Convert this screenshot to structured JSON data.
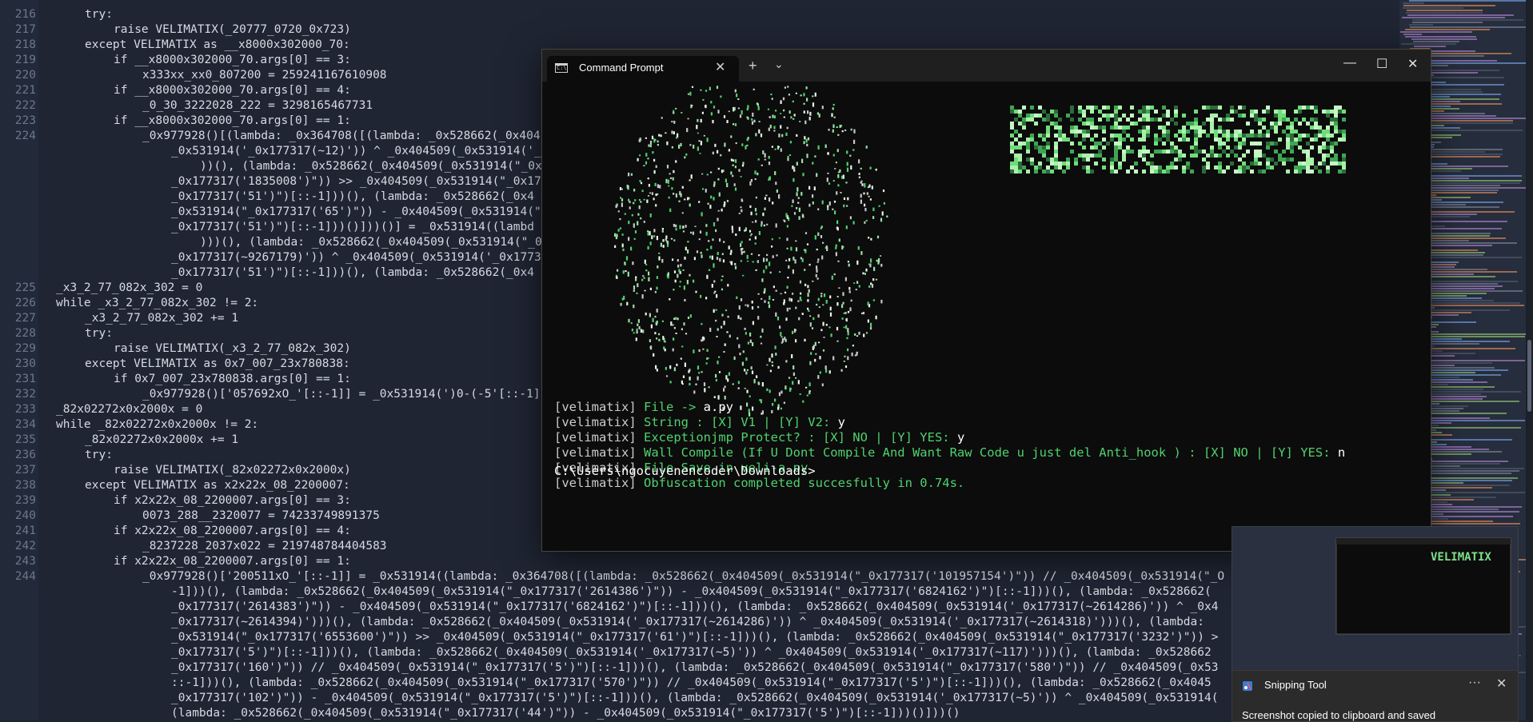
{
  "editor": {
    "lines": [
      {
        "n": "216",
        "indent": 1,
        "code": "try:"
      },
      {
        "n": "217",
        "indent": 2,
        "code": "raise VELIMATIX(_20777_0720_0x723)"
      },
      {
        "n": "218",
        "indent": 1,
        "code": "except VELIMATIX as __x8000x302000_70:"
      },
      {
        "n": "219",
        "indent": 2,
        "code": "if __x8000x302000_70.args[0] == 3:"
      },
      {
        "n": "220",
        "indent": 3,
        "code": "x333xx_xx0_807200 = 259241167610908"
      },
      {
        "n": "221",
        "indent": 2,
        "code": "if __x8000x302000_70.args[0] == 4:"
      },
      {
        "n": "222",
        "indent": 3,
        "code": "_0_30_3222028_222 = 3298165467731"
      },
      {
        "n": "223",
        "indent": 2,
        "code": "if __x8000x302000_70.args[0] == 1:"
      },
      {
        "n": "224",
        "indent": 3,
        "code": "_0x977928()[(lambda: _0x364708([(lambda: _0x528662(_0x404"
      },
      {
        "n": "",
        "indent": 4,
        "code": "_0x531914('_0x177317(~12)')) ^ _0x404509(_0x531914('_"
      },
      {
        "n": "",
        "indent": 5,
        "code": "))(), (lambda: _0x528662(_0x404509(_0x531914(\"_0x1773"
      },
      {
        "n": "",
        "indent": 4,
        "code": "_0x177317('1835008')\")) >> _0x404509(_0x531914(\"_0x17"
      },
      {
        "n": "",
        "indent": 4,
        "code": "_0x177317('51')\")[::-1]))(), (lambda: _0x528662(_0x4"
      },
      {
        "n": "",
        "indent": 4,
        "code": "_0x531914(\"_0x177317('65')\")) - _0x404509(_0x531914(\""
      },
      {
        "n": "",
        "indent": 4,
        "code": "_0x177317('51')\")[::-1]))()]))()] = _0x531914((lambd"
      },
      {
        "n": "",
        "indent": 5,
        "code": ")))(), (lambda: _0x528662(_0x404509(_0x531914(\"_0x177"
      },
      {
        "n": "",
        "indent": 4,
        "code": "_0x177317(~9267179)')) ^ _0x404509(_0x531914('_0x1773"
      },
      {
        "n": "",
        "indent": 4,
        "code": "_0x177317('51')\")[::-1]))(), (lambda: _0x528662(_0x4"
      },
      {
        "n": "225",
        "indent": 0,
        "code": "_x3_2_77_082x_302 = 0"
      },
      {
        "n": "226",
        "indent": 0,
        "code": "while _x3_2_77_082x_302 != 2:"
      },
      {
        "n": "227",
        "indent": 1,
        "code": "_x3_2_77_082x_302 += 1"
      },
      {
        "n": "228",
        "indent": 1,
        "code": "try:"
      },
      {
        "n": "229",
        "indent": 2,
        "code": "raise VELIMATIX(_x3_2_77_082x_302)"
      },
      {
        "n": "230",
        "indent": 1,
        "code": "except VELIMATIX as 0x7_007_23x780838:"
      },
      {
        "n": "231",
        "indent": 2,
        "code": "if 0x7_007_23x780838.args[0] == 1:"
      },
      {
        "n": "232",
        "indent": 3,
        "code": "_0x977928()['057692xO_'[::-1]] = _0x531914(')0-(-5'[::-1]"
      },
      {
        "n": "233",
        "indent": 0,
        "code": "_82x02272x0x2000x = 0"
      },
      {
        "n": "234",
        "indent": 0,
        "code": "while _82x02272x0x2000x != 2:"
      },
      {
        "n": "235",
        "indent": 1,
        "code": "_82x02272x0x2000x += 1"
      },
      {
        "n": "236",
        "indent": 1,
        "code": "try:"
      },
      {
        "n": "237",
        "indent": 2,
        "code": "raise VELIMATIX(_82x02272x0x2000x)"
      },
      {
        "n": "238",
        "indent": 1,
        "code": "except VELIMATIX as x2x22x_08_2200007:"
      },
      {
        "n": "239",
        "indent": 2,
        "code": "if x2x22x_08_2200007.args[0] == 3:"
      },
      {
        "n": "240",
        "indent": 3,
        "code": "0073_288__2320077 = 74233749891375"
      },
      {
        "n": "241",
        "indent": 2,
        "code": "if x2x22x_08_2200007.args[0] == 4:"
      },
      {
        "n": "242",
        "indent": 3,
        "code": "_8237228_2037x022 = 219748784404583"
      },
      {
        "n": "243",
        "indent": 2,
        "code": "if x2x22x_08_2200007.args[0] == 1:"
      },
      {
        "n": "244",
        "indent": 3,
        "code": "_0x977928()['200511xO_'[::-1]] = _0x531914((lambda: _0x364708([(lambda: _0x528662(_0x404509(_0x531914(\"_0x177317('101957154')\")) // _0x404509(_0x531914(\"_O"
      },
      {
        "n": "",
        "indent": 4,
        "code": "-1]))(), (lambda: _0x528662(_0x404509(_0x531914(\"_0x177317('2614386')\")) - _0x404509(_0x531914(\"_0x177317('6824162')\")[::-1]))(), (lambda: _0x528662("
      },
      {
        "n": "",
        "indent": 4,
        "code": "_0x177317('2614383')\")) - _0x404509(_0x531914(\"_0x177317('6824162')\")[::-1]))(), (lambda: _0x528662(_0x404509(_0x531914('_0x177317(~2614286)')) ^ _0x4"
      },
      {
        "n": "",
        "indent": 4,
        "code": "_0x177317(~2614394)')))(), (lambda: _0x528662(_0x404509(_0x531914('_0x177317(~2614286)')) ^ _0x404509(_0x531914('_0x177317(~2614318)')))(), (lambda:"
      },
      {
        "n": "",
        "indent": 4,
        "code": "_0x531914(\"_0x177317('6553600')\")) >> _0x404509(_0x531914(\"_0x177317('61')\")[::-1]))(), (lambda: _0x528662(_0x404509(_0x531914(\"_0x177317('3232')\")) >"
      },
      {
        "n": "",
        "indent": 4,
        "code": "_0x177317('5')\")[::-1]))(), (lambda: _0x528662(_0x404509(_0x531914('_0x177317(~5)')) ^ _0x404509(_0x531914('_0x177317(~117)')))(), (lambda: _0x528662"
      },
      {
        "n": "",
        "indent": 4,
        "code": "_0x177317('160')\")) // _0x404509(_0x531914(\"_0x177317('5')\")[::-1]))(), (lambda: _0x528662(_0x404509(_0x531914(\"_0x177317('580')\")) // _0x404509(_0x53"
      },
      {
        "n": "",
        "indent": 4,
        "code": "::-1]))(), (lambda: _0x528662(_0x404509(_0x531914(\"_0x177317('570')\")) // _0x404509(_0x531914(\"_0x177317('5')\")[::-1]))(), (lambda: _0x528662(_0x4045"
      },
      {
        "n": "",
        "indent": 4,
        "code": "_0x177317('102')\")) - _0x404509(_0x531914(\"_0x177317('5')\")[::-1]))(), (lambda: _0x528662(_0x404509(_0x531914('_0x177317(~5)')) ^ _0x404509(_0x531914("
      },
      {
        "n": "",
        "indent": 4,
        "code": "(lambda: _0x528662(_0x404509(_0x531914(\"_0x177317('44')\")) - _0x404509(_0x531914(\"_0x177317('5')\")[::-1]))()]))()"
      }
    ]
  },
  "cmd": {
    "tab_title": "Command Prompt",
    "new_tab": "+",
    "dropdown": "⌄",
    "minimize": "—",
    "maximize": "☐",
    "close": "✕",
    "tab_close": "✕",
    "logo_text": "VELIMATIX",
    "lines": [
      {
        "tag": "[velimatix]",
        "text": "File -> ",
        "value": "a.py"
      },
      {
        "tag": "[velimatix]",
        "text": "String : [X] V1 | [Y] V2: ",
        "value": "y"
      },
      {
        "tag": "[velimatix]",
        "text": "Exceptionjmp Protect? : [X] NO | [Y] YES: ",
        "value": "y"
      },
      {
        "tag": "[velimatix]",
        "text": "Wall Compile (If U Dont Compile And Want Raw Code u just del Anti_hook ) : [X] NO | [Y] YES: ",
        "value": "n"
      },
      {
        "tag": "[velimatix]",
        "text": "File Save in veli-a.py",
        "value": ""
      },
      {
        "tag": "[velimatix]",
        "text": "Obfuscation completed succesfully in 0.74s.",
        "value": ""
      }
    ],
    "prompt": "C:\\Users\\ngocuyenencoder\\Downloads>"
  },
  "snipping_tool": {
    "title": "Snipping Tool",
    "more": "···",
    "close": "✕",
    "message": "Screenshot copied to clipboard and saved",
    "thumb_logo": "VELIMATIX"
  },
  "colors": {
    "terminal_green": "#4fd16e",
    "editor_bg": "#1f2533",
    "terminal_bg": "#0c0c0c"
  }
}
